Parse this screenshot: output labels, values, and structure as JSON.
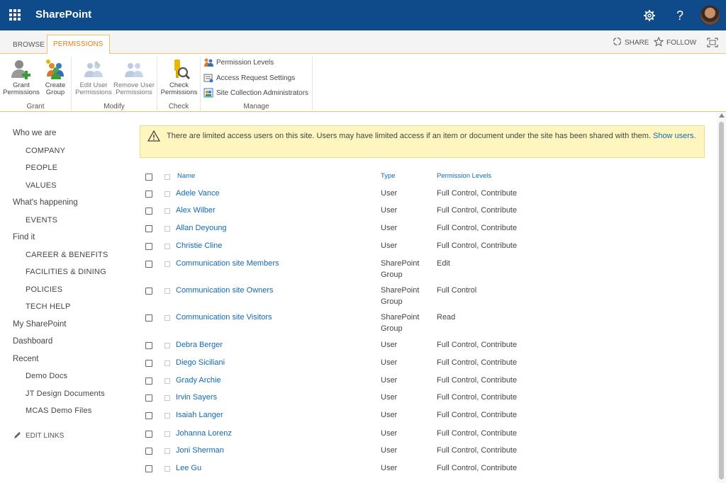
{
  "suitebar": {
    "brand": "SharePoint",
    "icons": [
      "app-launcher-icon",
      "settings-icon",
      "help-icon",
      "avatar"
    ]
  },
  "ribbon": {
    "tabs": [
      {
        "label": "BROWSE",
        "active": false
      },
      {
        "label": "PERMISSIONS",
        "active": true
      }
    ],
    "share_label": "SHARE",
    "follow_label": "FOLLOW",
    "groups": {
      "grant": {
        "label": "Grant",
        "grant_permissions": [
          "Grant",
          "Permissions"
        ],
        "create_group": [
          "Create",
          "Group"
        ]
      },
      "modify": {
        "label": "Modify",
        "edit_user_permissions": [
          "Edit User",
          "Permissions"
        ],
        "remove_user_permissions": [
          "Remove User",
          "Permissions"
        ]
      },
      "check": {
        "label": "Check",
        "check_permissions": [
          "Check",
          "Permissions"
        ]
      },
      "manage": {
        "label": "Manage",
        "permission_levels": "Permission Levels",
        "access_request_settings": "Access Request Settings",
        "site_collection_admins": "Site Collection Administrators"
      }
    }
  },
  "nav": {
    "who_we_are": "Who we are",
    "company": "COMPANY",
    "people": "PEOPLE",
    "values": "VALUES",
    "whats_happening": "What's happening",
    "events": "EVENTS",
    "find_it": "Find it",
    "career": "CAREER & BENEFITS",
    "facilities": "FACILITIES & DINING",
    "policies": "POLICIES",
    "tech_help": "TECH HELP",
    "my_sharepoint": "My SharePoint",
    "dashboard": "Dashboard",
    "recent": "Recent",
    "demo_docs": "Demo Docs",
    "jt_design": "JT Design Documents",
    "mcas": "MCAS Demo Files",
    "edit_links": "EDIT LINKS"
  },
  "warning": {
    "text": "There are limited access users on this site. Users may have limited access if an item or document under the site has been shared with them. ",
    "link": "Show users."
  },
  "table": {
    "headers": {
      "name": "Name",
      "type": "Type",
      "permission": "Permission Levels"
    },
    "rows": [
      {
        "name": "Adele Vance",
        "type": "User",
        "permission": "Full Control, Contribute"
      },
      {
        "name": "Alex Wilber",
        "type": "User",
        "permission": "Full Control, Contribute"
      },
      {
        "name": "Allan Deyoung",
        "type": "User",
        "permission": "Full Control, Contribute"
      },
      {
        "name": "Christie Cline",
        "type": "User",
        "permission": "Full Control, Contribute"
      },
      {
        "name": "Communication site Members",
        "type": "SharePoint Group",
        "permission": "Edit"
      },
      {
        "name": "Communication site Owners",
        "type": "SharePoint Group",
        "permission": "Full Control"
      },
      {
        "name": "Communication site Visitors",
        "type": "SharePoint Group",
        "permission": "Read"
      },
      {
        "name": "Debra Berger",
        "type": "User",
        "permission": "Full Control, Contribute"
      },
      {
        "name": "Diego Siciliani",
        "type": "User",
        "permission": "Full Control, Contribute"
      },
      {
        "name": "Grady Archie",
        "type": "User",
        "permission": "Full Control, Contribute"
      },
      {
        "name": "Irvin Sayers",
        "type": "User",
        "permission": "Full Control, Contribute"
      },
      {
        "name": "Isaiah Langer",
        "type": "User",
        "permission": "Full Control, Contribute"
      },
      {
        "name": "Johanna Lorenz",
        "type": "User",
        "permission": "Full Control, Contribute"
      },
      {
        "name": "Joni Sherman",
        "type": "User",
        "permission": "Full Control, Contribute"
      },
      {
        "name": "Lee Gu",
        "type": "User",
        "permission": "Full Control, Contribute"
      }
    ]
  },
  "colors": {
    "suitebar": "#0f4a8a",
    "accent": "#e07c17",
    "link": "#0f6ab4",
    "warning_bg": "#fff6bf"
  }
}
